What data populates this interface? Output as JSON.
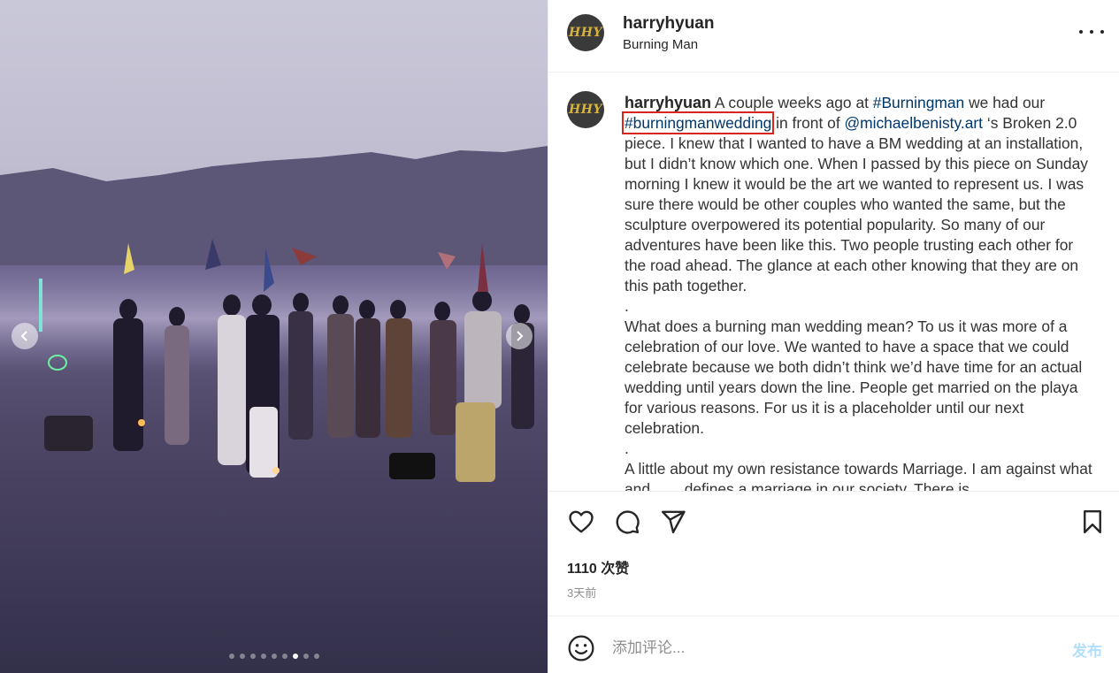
{
  "post": {
    "username": "harryhyuan",
    "location": "Burning Man",
    "avatar_initials": "HHY",
    "media": {
      "slide_count": 9,
      "active_slide": 7
    }
  },
  "caption": {
    "username": "harryhyuan",
    "p1_a": " A couple weeks ago at ",
    "tag_burningman": "#Burningman",
    "p1_b": " we had our ",
    "tag_wedding": "#burningmanwedding",
    "p1_c": " in front of ",
    "mention": "@michaelbenisty.art",
    "p1_d": " ‘s Broken 2.0 piece. I knew that I wanted to have a BM wedding at an installation, but I didn’t know which one. When I passed by this piece on Sunday morning I knew it would be the art we wanted to represent us. I was sure there would be other couples who wanted the same, but the sculpture overpowered its potential popularity. So many of our adventures have been like this. Two people trusting each other for the road ahead. The glance at each other knowing that they are on this path together.",
    "sep1": ".",
    "p2": "What does a burning man wedding mean? To us it was more of a celebration of our love. We wanted to have a space that we could celebrate because we both didn’t think we’d have time for an actual wedding until years down the line. People get married on the playa for various reasons. For us it is a placeholder until our next celebration.",
    "sep2": ".",
    "p3": "A little about my own resistance towards Marriage. I am against what and ___ defines a marriage in our society. There is"
  },
  "stats": {
    "likes": "1110 次赞",
    "time_ago": "3天前"
  },
  "comment": {
    "placeholder": "添加评论...",
    "publish_label": "发布"
  },
  "colors": {
    "link": "#00376b",
    "highlight_box": "#d9261c",
    "publish_disabled": "#b2dffc",
    "avatar_bg": "#3a3a3a",
    "avatar_text": "#d8b23a"
  },
  "icons": [
    "chevron-left-icon",
    "chevron-right-icon",
    "more-icon",
    "heart-icon",
    "comment-icon",
    "share-icon",
    "bookmark-icon",
    "emoji-icon"
  ]
}
